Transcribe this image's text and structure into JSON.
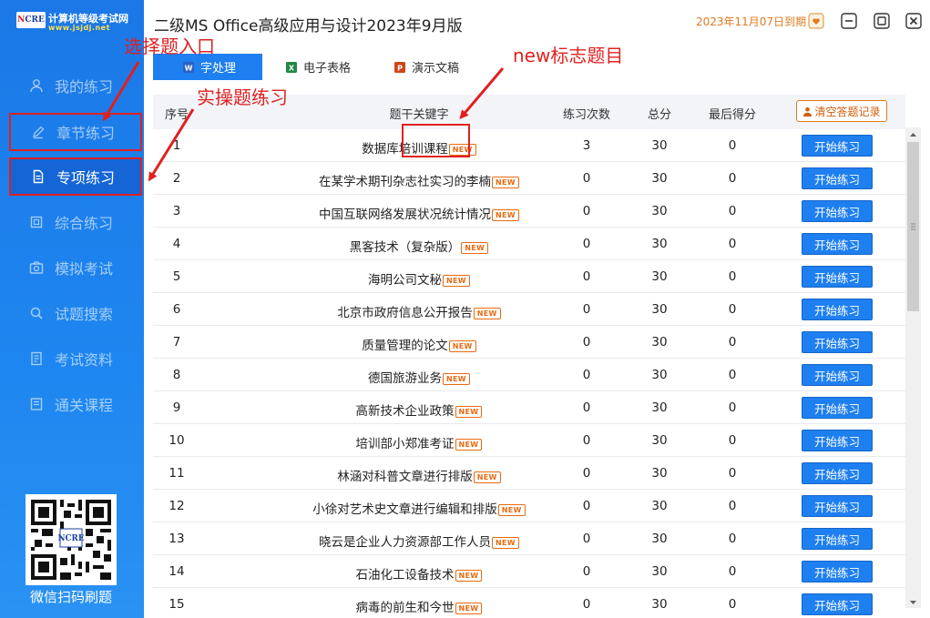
{
  "logo": {
    "badge_n": "N",
    "badge_rest": "CRE",
    "title": "计算机等级考试网",
    "url": "www.jsjdj.net"
  },
  "app": {
    "title": "二级MS Office高级应用与设计2023年9月版",
    "expiry": "2023年11月07日到期"
  },
  "sidebar": {
    "items": [
      {
        "label": "我的练习",
        "icon": "user-icon"
      },
      {
        "label": "章节练习",
        "icon": "edit-icon"
      },
      {
        "label": "专项练习",
        "icon": "document-icon"
      },
      {
        "label": "综合练习",
        "icon": "layers-icon"
      },
      {
        "label": "模拟考试",
        "icon": "camera-icon"
      },
      {
        "label": "试题搜索",
        "icon": "search-icon"
      },
      {
        "label": "考试资料",
        "icon": "file-icon"
      },
      {
        "label": "通关课程",
        "icon": "course-icon"
      }
    ],
    "qr_caption": "微信扫码刷题"
  },
  "tabs": [
    {
      "label": "字处理",
      "icon": "word-icon"
    },
    {
      "label": "电子表格",
      "icon": "excel-icon"
    },
    {
      "label": "演示文稿",
      "icon": "powerpoint-icon"
    }
  ],
  "table": {
    "headers": {
      "no": "序号",
      "topic": "题干关键字",
      "count": "练习次数",
      "total": "总分",
      "last": "最后得分"
    },
    "clear_button": "清空答题记录",
    "new_badge": "NEW",
    "start_button": "开始练习",
    "rows": [
      {
        "no": "1",
        "topic": "数据库培训课程",
        "count": "3",
        "total": "30",
        "score": "0"
      },
      {
        "no": "2",
        "topic": "在某学术期刊杂志社实习的李楠",
        "count": "0",
        "total": "30",
        "score": "0"
      },
      {
        "no": "3",
        "topic": "中国互联网络发展状况统计情况",
        "count": "0",
        "total": "30",
        "score": "0"
      },
      {
        "no": "4",
        "topic": "黑客技术（复杂版）",
        "count": "0",
        "total": "30",
        "score": "0"
      },
      {
        "no": "5",
        "topic": "海明公司文秘",
        "count": "0",
        "total": "30",
        "score": "0"
      },
      {
        "no": "6",
        "topic": "北京市政府信息公开报告",
        "count": "0",
        "total": "30",
        "score": "0"
      },
      {
        "no": "7",
        "topic": "质量管理的论文",
        "count": "0",
        "total": "30",
        "score": "0"
      },
      {
        "no": "8",
        "topic": "德国旅游业务",
        "count": "0",
        "total": "30",
        "score": "0"
      },
      {
        "no": "9",
        "topic": "高新技术企业政策",
        "count": "0",
        "total": "30",
        "score": "0"
      },
      {
        "no": "10",
        "topic": "培训部小郑准考证",
        "count": "0",
        "total": "30",
        "score": "0"
      },
      {
        "no": "11",
        "topic": "林涵对科普文章进行排版",
        "count": "0",
        "total": "30",
        "score": "0"
      },
      {
        "no": "12",
        "topic": "小徐对艺术史文章进行编辑和排版",
        "count": "0",
        "total": "30",
        "score": "0"
      },
      {
        "no": "13",
        "topic": "晓云是企业人力资源部工作人员",
        "count": "0",
        "total": "30",
        "score": "0"
      },
      {
        "no": "14",
        "topic": "石油化工设备技术",
        "count": "0",
        "total": "30",
        "score": "0"
      },
      {
        "no": "15",
        "topic": "病毒的前生和今世",
        "count": "0",
        "total": "30",
        "score": "0"
      }
    ]
  },
  "annotations": {
    "choice_entry": "选择题入口",
    "practical": "实操题练习",
    "new_topics": "new标志题目"
  },
  "colors": {
    "sidebar_blue": "#1e86f0",
    "accent_blue": "#1e7ff0",
    "annotation_red": "#e02020",
    "new_orange": "#e86a10",
    "expiry_orange": "#e07a1f"
  }
}
